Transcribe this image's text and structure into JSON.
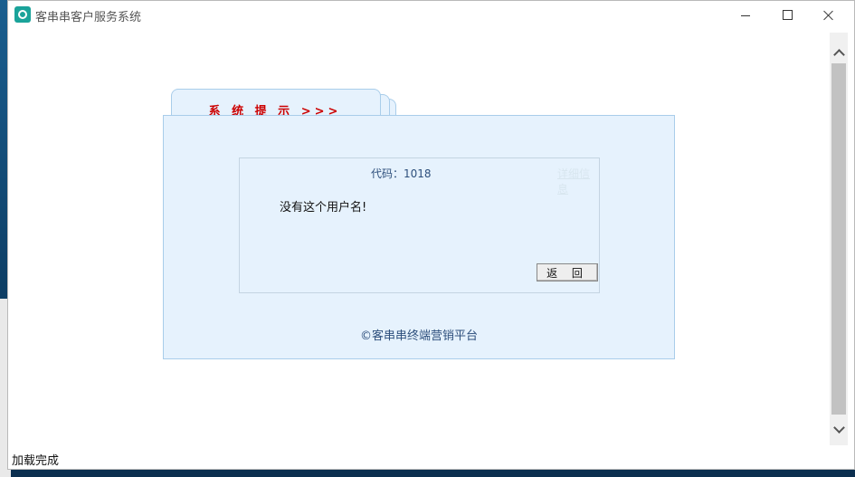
{
  "window": {
    "title": "客串串客户服务系统"
  },
  "dialog": {
    "tab_title": "系 统 提 示 >>>",
    "code_label": "代码：1018",
    "details_link": "详细信息",
    "message": "没有这个用户名!",
    "return_button": "返 回",
    "footer": "©客串串终端营销平台"
  },
  "status": {
    "text": "加载完成"
  },
  "icons": {
    "app": "app-icon",
    "minimize": "minimize-icon",
    "maximize": "maximize-icon",
    "close": "close-icon",
    "scroll_up": "chevron-up-icon",
    "scroll_down": "chevron-down-icon"
  }
}
